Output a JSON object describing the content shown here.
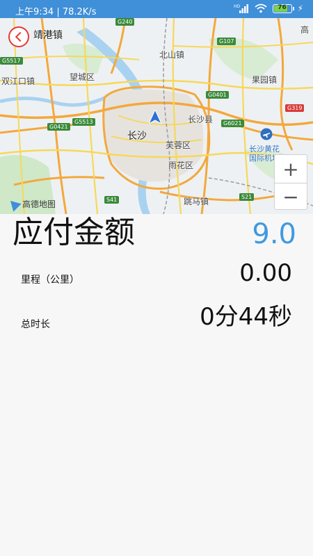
{
  "status_bar": {
    "left_text": "上午9:34 | 78.2K/s",
    "hd_badge": "HD",
    "battery_level": "76",
    "icons": [
      "signal-icon",
      "wifi-icon",
      "battery-icon",
      "charging-icon"
    ]
  },
  "map": {
    "back_label": "靖港镇",
    "city_label": "长沙",
    "logo_text": "高德地图",
    "zoom_in_label": "+",
    "zoom_out_label": "−",
    "labels": {
      "beishan": "北山镇",
      "wangcheng": "望城区",
      "shuangjiangkou": "双江口镇",
      "guoyuan": "果园镇",
      "changsha_county": "长沙县",
      "furong": "芙蓉区",
      "yuhua": "雨花区",
      "tiaoma": "跳马镇",
      "airport_line1": "长沙黄花",
      "airport_line2": "国际机场",
      "gao": "高"
    },
    "shields": {
      "g240": "G240",
      "g107": "G107",
      "g5517": "G5517",
      "g0401": "G0401",
      "g319": "G319",
      "g0421": "G0421",
      "g5513": "G5513",
      "g6021": "G6021",
      "s41": "S41",
      "s21": "S21"
    }
  },
  "fare": {
    "label": "应付金额",
    "value": "9.0",
    "accent_color": "#3e9ae0"
  },
  "mileage": {
    "label": "里程（公里）",
    "value": "0.00"
  },
  "duration": {
    "label": "总时长",
    "value": "0分44秒"
  }
}
